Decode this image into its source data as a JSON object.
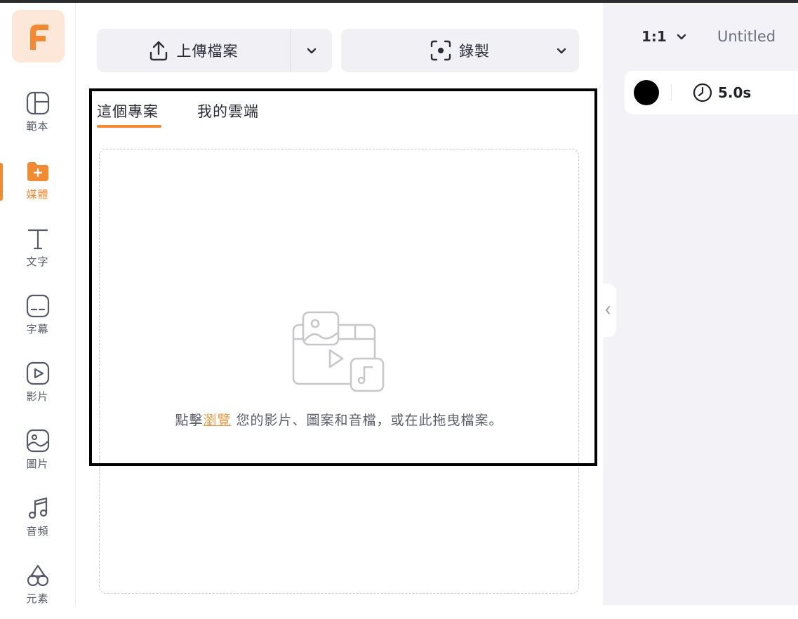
{
  "sidebar": {
    "items": [
      {
        "label": "範本",
        "icon": "template-icon"
      },
      {
        "label": "媒體",
        "icon": "media-folder-icon",
        "active": true
      },
      {
        "label": "文字",
        "icon": "text-icon"
      },
      {
        "label": "字幕",
        "icon": "subtitle-icon"
      },
      {
        "label": "影片",
        "icon": "video-icon"
      },
      {
        "label": "圖片",
        "icon": "image-icon"
      },
      {
        "label": "音頻",
        "icon": "music-icon"
      },
      {
        "label": "元素",
        "icon": "elements-icon"
      }
    ]
  },
  "toolbar": {
    "upload_label": "上傳檔案",
    "record_label": "錄製"
  },
  "tabs": [
    {
      "label": "這個專案",
      "active": true
    },
    {
      "label": "我的雲端",
      "active": false
    }
  ],
  "dropzone": {
    "text_before": "點擊",
    "link": "瀏覽",
    "text_after": " 您的影片、圖案和音檔，或在此拖曳檔案。"
  },
  "right_panel": {
    "ratio": "1:1",
    "title": "Untitled",
    "scene": {
      "color": "#000000",
      "duration": "5.0s"
    }
  },
  "colors": {
    "accent": "#f28a33",
    "link": "#e39a45",
    "button_bg": "#f1f1f5",
    "panel_bg": "#f2f2f7"
  }
}
